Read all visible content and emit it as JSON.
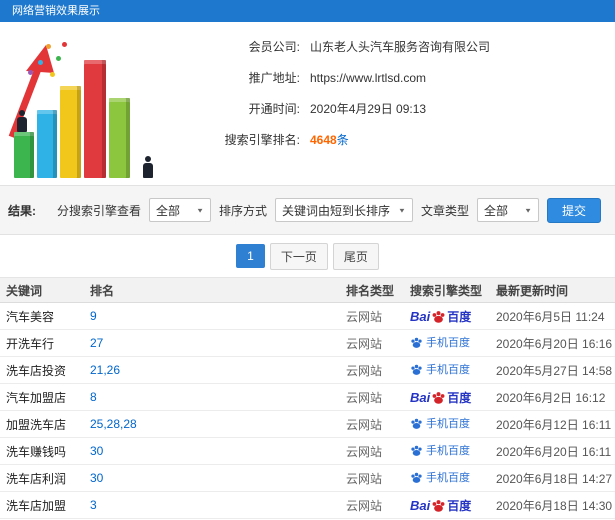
{
  "header": {
    "title": "网络营销效果展示"
  },
  "info": {
    "company_label": "会员公司:",
    "company_value": "山东老人头汽车服务咨询有限公司",
    "url_label": "推广地址:",
    "url_value": "https://www.lrtlsd.com",
    "open_label": "开通时间:",
    "open_value": "2020年4月29日 09:13",
    "rank_label": "搜索引擎排名:",
    "rank_value": "4648",
    "rank_unit": "条"
  },
  "filters": {
    "result_label": "结果:",
    "engine_label": "分搜索引擎查看",
    "engine_value": "全部",
    "sort_label": "排序方式",
    "sort_value": "关键词由短到长排序",
    "type_label": "文章类型",
    "type_value": "全部",
    "submit_label": "提交"
  },
  "pagination": {
    "current": "1",
    "next": "下一页",
    "last": "尾页"
  },
  "table": {
    "headers": [
      "关键词",
      "排名",
      "排名类型",
      "搜索引擎类型",
      "最新更新时间"
    ],
    "engine_labels": {
      "baidu_prefix": "Bai",
      "baidu_suffix": "百度",
      "mobile": "手机百度"
    },
    "rows": [
      {
        "keyword": "汽车美容",
        "rank": "9",
        "rank_type": "云网站",
        "engine": "baidu",
        "time": "2020年6月5日 11:24"
      },
      {
        "keyword": "开洗车行",
        "rank": "27",
        "rank_type": "云网站",
        "engine": "mobile",
        "time": "2020年6月20日 16:16"
      },
      {
        "keyword": "洗车店投资",
        "rank": "21,26",
        "rank_type": "云网站",
        "engine": "mobile",
        "time": "2020年5月27日 14:58"
      },
      {
        "keyword": "汽车加盟店",
        "rank": "8",
        "rank_type": "云网站",
        "engine": "baidu",
        "time": "2020年6月2日 16:12"
      },
      {
        "keyword": "加盟洗车店",
        "rank": "25,28,28",
        "rank_type": "云网站",
        "engine": "mobile",
        "time": "2020年6月12日 16:11"
      },
      {
        "keyword": "洗车赚钱吗",
        "rank": "30",
        "rank_type": "云网站",
        "engine": "mobile",
        "time": "2020年6月20日 16:11"
      },
      {
        "keyword": "洗车店利润",
        "rank": "30",
        "rank_type": "云网站",
        "engine": "mobile",
        "time": "2020年6月18日 14:27"
      },
      {
        "keyword": "洗车店加盟",
        "rank": "3",
        "rank_type": "云网站",
        "engine": "baidu",
        "time": "2020年6月18日 14:30"
      }
    ]
  },
  "icons": {
    "select_arrow": "▼"
  },
  "colors": {
    "header_bg": "#1e78cd",
    "link_blue": "#0066cc",
    "highlight_orange": "#ff6600",
    "submit_blue": "#2f8be0",
    "baidu_blue": "#2534c4",
    "baidu_red": "#d5232a",
    "mobile_baidu_blue": "#2a6fd4"
  }
}
